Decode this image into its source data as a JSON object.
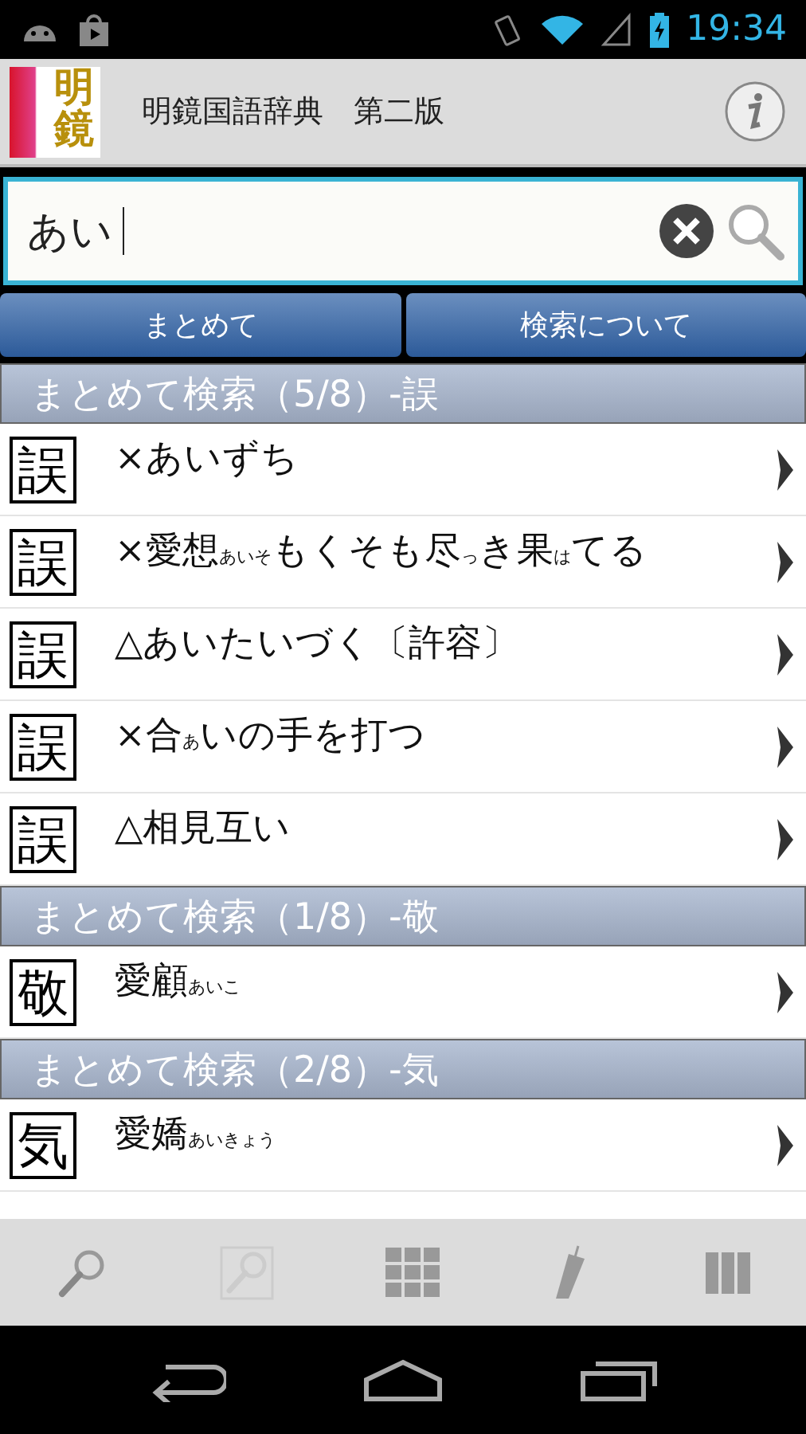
{
  "status_bar": {
    "time": "19:34"
  },
  "header": {
    "logo": "明鏡",
    "title": "明鏡国語辞典　第二版"
  },
  "search": {
    "value": "あい"
  },
  "buttons": [
    "まとめて",
    "検索について"
  ],
  "sections": [
    {
      "title": "まとめて検索（5/8）-誤",
      "entries": [
        {
          "badge": "誤",
          "text": "×あいずち"
        },
        {
          "badge": "誤",
          "text": "×愛想$_{あいそ}$もくそも尽$_{っ}$き果$_{は}$てる"
        },
        {
          "badge": "誤",
          "text": "△あいたいづく〔許容〕"
        },
        {
          "badge": "誤",
          "text": "×合$_{あ}$いの手を打つ"
        },
        {
          "badge": "誤",
          "text": "△相見互い"
        }
      ]
    },
    {
      "title": "まとめて検索（1/8）-敬",
      "entries": [
        {
          "badge": "敬",
          "text": "愛顧$_{あいこ}$"
        }
      ]
    },
    {
      "title": "まとめて検索（2/8）-気",
      "entries": [
        {
          "badge": "気",
          "text": "愛嬌$_{あいきょう}$"
        }
      ]
    }
  ]
}
